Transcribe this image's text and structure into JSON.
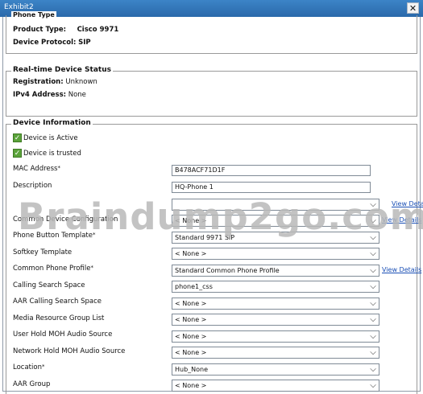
{
  "window": {
    "title": "Exhibit2",
    "close_glyph": "✕"
  },
  "phone_type": {
    "legend": "Phone Type",
    "product_type_label": "Product Type:",
    "product_type_value": "Cisco 9971",
    "device_protocol_label": "Device Protocol:",
    "device_protocol_value": "SIP"
  },
  "status": {
    "legend": "Real-time Device Status",
    "registration_label": "Registration:",
    "registration_value": "Unknown",
    "ipv4_label": "IPv4 Address:",
    "ipv4_value": "None"
  },
  "device_info": {
    "legend": "Device Information",
    "active_label": "Device is Active",
    "trusted_label": "Device is trusted",
    "mac_label": "MAC Address",
    "mac_value": "B478ACF71D1F",
    "description_label": "Description",
    "description_value": "HQ-Phone 1",
    "view_details": "View Details",
    "rows": [
      {
        "label": "Common Device Configuration",
        "value": "< None >"
      },
      {
        "label": "Phone Button Template",
        "value": "Standard 9971 SIP"
      },
      {
        "label": "Softkey Template",
        "value": "< None >"
      },
      {
        "label": "Common Phone Profile",
        "value": "Standard Common Phone Profile"
      },
      {
        "label": "Calling Search Space",
        "value": "phone1_css"
      },
      {
        "label": "AAR Calling Search Space",
        "value": "< None >"
      },
      {
        "label": "Media Resource Group List",
        "value": "< None >"
      },
      {
        "label": "User Hold MOH Audio Source",
        "value": "< None >"
      },
      {
        "label": "Network Hold MOH Audio Source",
        "value": "< None >"
      },
      {
        "label": "Location",
        "value": "Hub_None"
      },
      {
        "label": "AAR Group",
        "value": "< None >"
      }
    ],
    "required_mark": "*"
  },
  "watermark": "Braindump2go.com",
  "colors": {
    "titlebar": "#2f74b8",
    "link": "#1a4fb5",
    "check": "#5aa33a"
  }
}
